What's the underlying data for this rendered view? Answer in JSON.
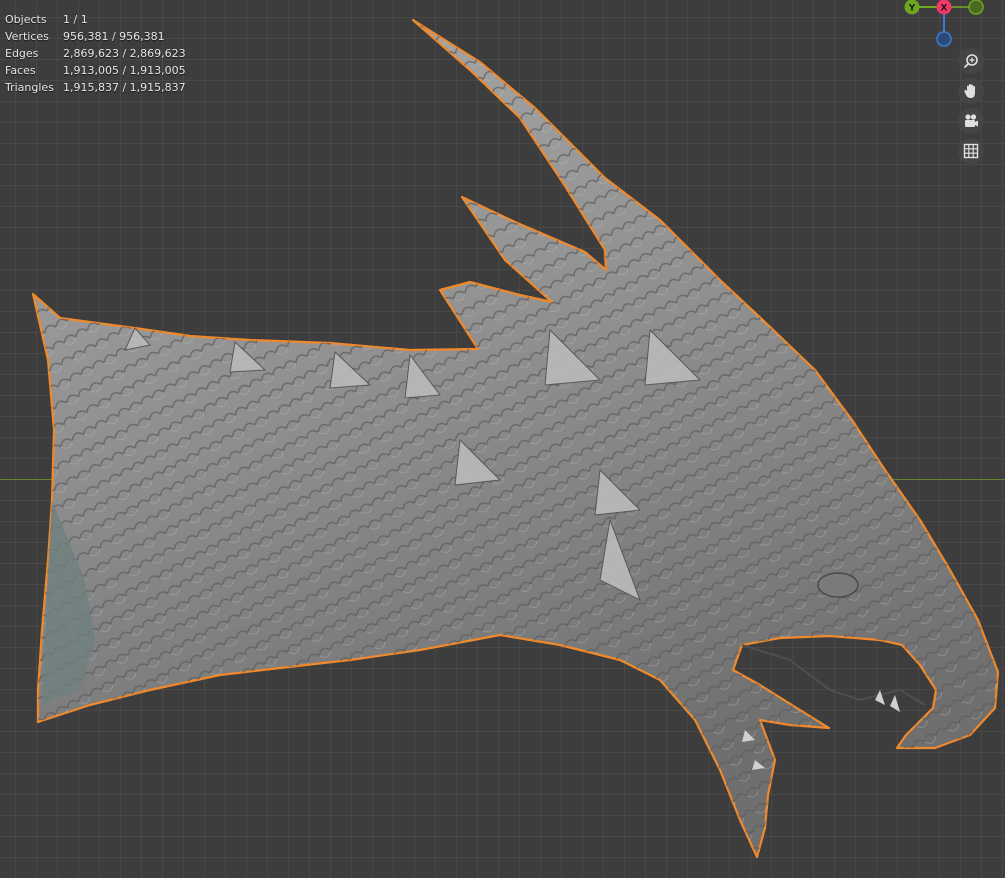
{
  "viewport": {
    "stats": [
      {
        "label": "Objects",
        "value": "1 / 1"
      },
      {
        "label": "Vertices",
        "value": "956,381 / 956,381"
      },
      {
        "label": "Edges",
        "value": "2,869,623 / 2,869,623"
      },
      {
        "label": "Faces",
        "value": "1,913,005 / 1,913,005"
      },
      {
        "label": "Triangles",
        "value": "1,915,837 / 1,915,837"
      }
    ],
    "gizmo": {
      "y_label": "Y",
      "x_label": "X",
      "colors": {
        "x": "#f5386a",
        "y": "#6ea61e",
        "z": "#3d7cd6"
      }
    },
    "nav_buttons": [
      "zoom-icon",
      "hand-pan-icon",
      "camera-icon",
      "grid-icon"
    ],
    "colors": {
      "background": "#3d3d3d",
      "selection_outline": "#f0892b",
      "x_axis_line": "#6b8e2a"
    }
  }
}
